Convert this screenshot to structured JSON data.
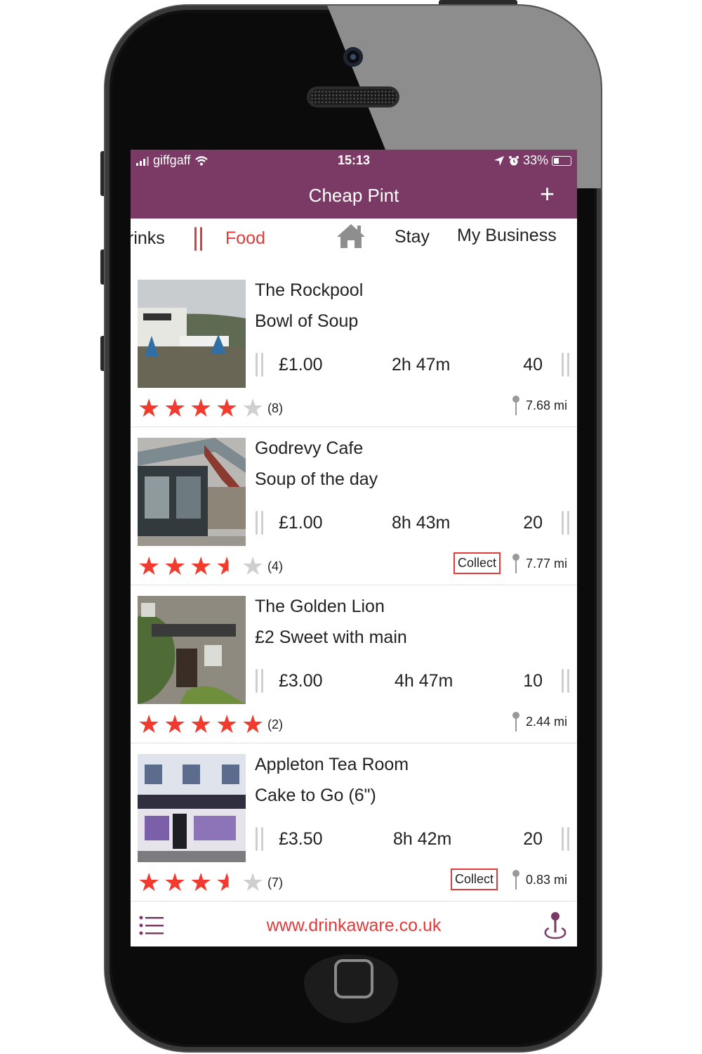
{
  "status_bar": {
    "carrier": "giffgaff",
    "time": "15:13",
    "battery": "33%"
  },
  "header": {
    "title": "Cheap Pint",
    "add_label": "+"
  },
  "tabs": [
    {
      "label": "Drinks",
      "visible_text": "rinks",
      "icon": "fork-knife-icon"
    },
    {
      "label": "Food",
      "active": true
    },
    {
      "label": "",
      "icon": "home-icon"
    },
    {
      "label": "Stay"
    },
    {
      "label": "My Business"
    }
  ],
  "listings": [
    {
      "venue": "The Rockpool",
      "deal": "Bowl of Soup",
      "price": "£1.00",
      "time_left": "2h 47m",
      "quantity": "40",
      "rating": 4,
      "rating_count": "(8)",
      "collect": "",
      "distance": "7.68 mi"
    },
    {
      "venue": "Godrevy Cafe",
      "deal": "Soup of the day",
      "price": "£1.00",
      "time_left": "8h 43m",
      "quantity": "20",
      "rating": 3.5,
      "rating_count": "(4)",
      "collect": "Collect",
      "distance": "7.77 mi"
    },
    {
      "venue": "The Golden Lion",
      "deal": "£2 Sweet with main",
      "price": "£3.00",
      "time_left": "4h 47m",
      "quantity": "10",
      "rating": 5,
      "rating_count": "(2)",
      "collect": "",
      "distance": "2.44 mi"
    },
    {
      "venue": "Appleton Tea Room",
      "deal": "Cake to Go (6\")",
      "price": "£3.50",
      "time_left": "8h 42m",
      "quantity": "20",
      "rating": 3.5,
      "rating_count": "(7)",
      "collect": "Collect",
      "distance": "0.83 mi"
    }
  ],
  "footer": {
    "link": "www.drinkaware.co.uk",
    "menu_icon": "list-icon",
    "map_icon": "map-pin-icon"
  },
  "colors": {
    "brand": "#7b3a66",
    "accent": "#e23a3a",
    "star": "#f23b2e"
  }
}
